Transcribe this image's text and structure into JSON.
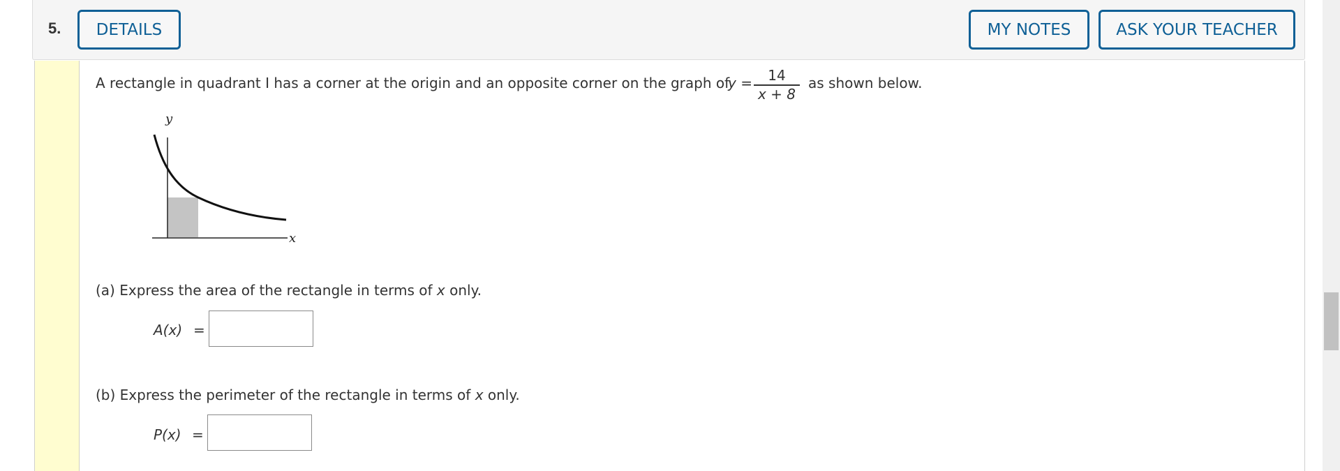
{
  "question": {
    "number": "5.",
    "buttons": {
      "details": "DETAILS",
      "my_notes": "MY NOTES",
      "ask_teacher": "ASK YOUR TEACHER"
    },
    "intro_text": "A rectangle in quadrant I has a corner at the origin and an opposite corner on the graph of",
    "equation_lhs": "y =",
    "fraction_numerator": "14",
    "fraction_denominator": "x + 8",
    "intro_suffix": "as shown below.",
    "graph": {
      "x_axis_label": "x",
      "y_axis_label": "y",
      "curve": "y = 14/(x + 8)",
      "shaded_region": "rectangle from origin to point on curve"
    },
    "part_a": {
      "prompt_prefix": "(a) Express the area of the rectangle in terms of",
      "prompt_var": "x",
      "prompt_suffix": "only.",
      "label": "A(x)",
      "equals": "=",
      "value": ""
    },
    "part_b": {
      "prompt_prefix": "(b) Express the perimeter of the rectangle in terms of",
      "prompt_var": "x",
      "prompt_suffix": "only.",
      "label": "P(x)",
      "equals": "=",
      "value": ""
    }
  },
  "colors": {
    "accent": "#0f6096",
    "sidebar_band": "#fffdd0",
    "header_bg": "#f5f5f5"
  }
}
